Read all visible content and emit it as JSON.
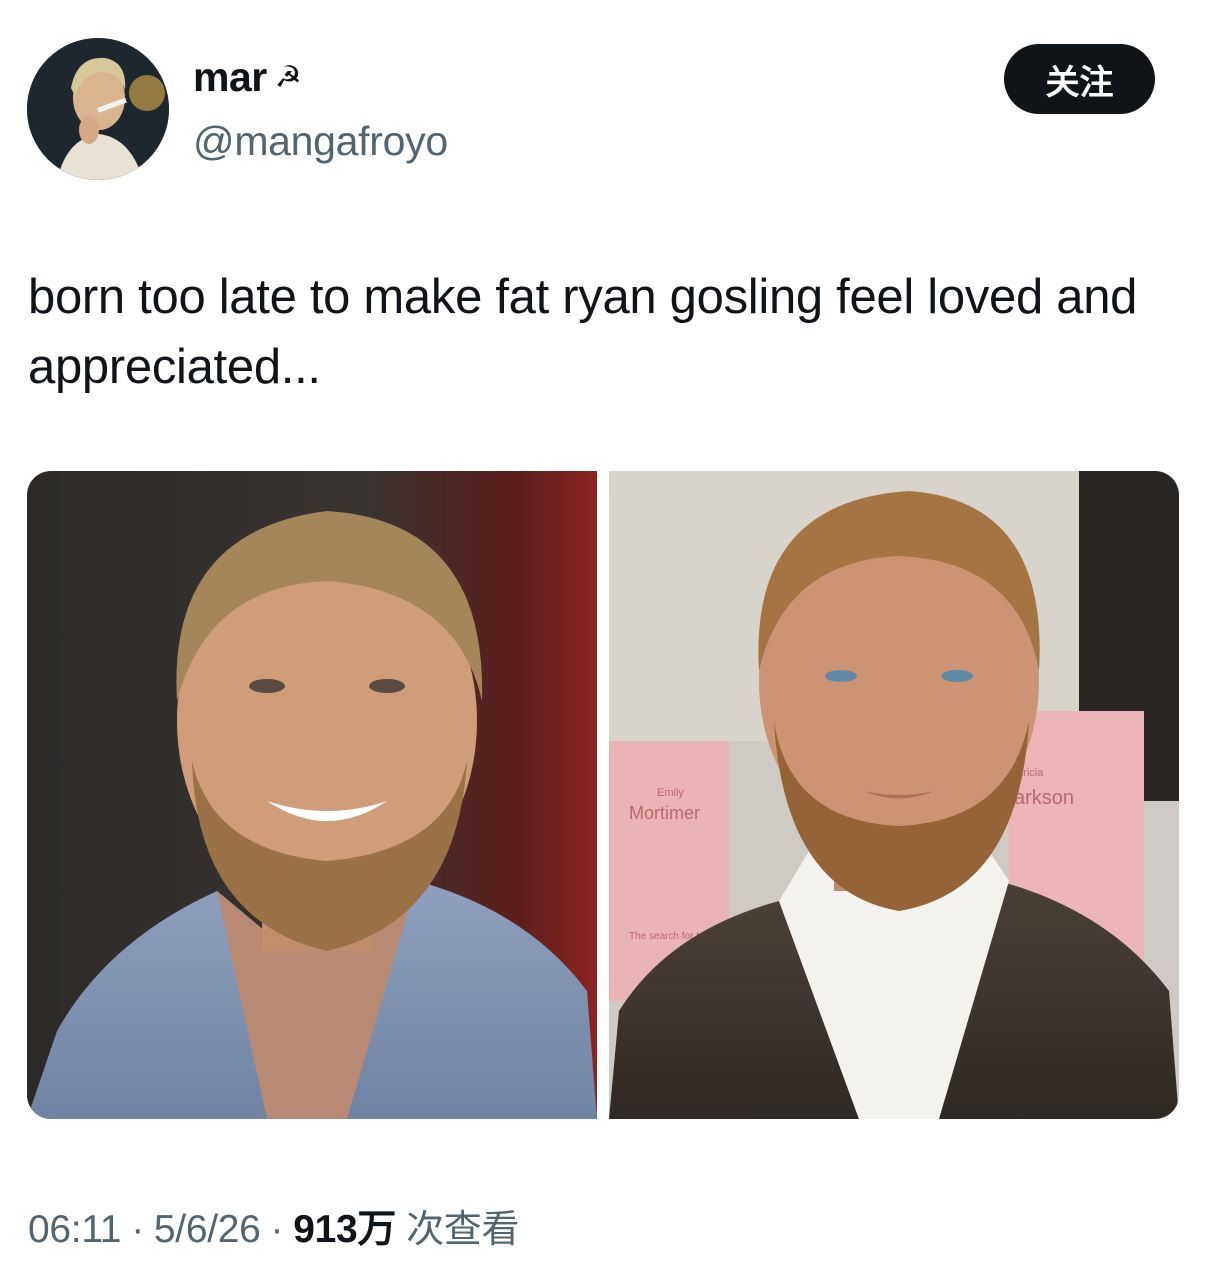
{
  "user": {
    "display_name": "mar",
    "name_emoji": "☭",
    "handle": "@mangafroyo",
    "avatar": "profile-photo-icon"
  },
  "follow_button": {
    "label": "关注"
  },
  "tweet": {
    "text": "born too late to make fat ryan gosling feel loved and appreciated..."
  },
  "media": {
    "images": [
      {
        "name": "photo-smiling-man-blue-shirt"
      },
      {
        "name": "photo-man-event-backdrop",
        "backdrop_text": {
          "left_small": "Emily",
          "left_big": "Mortimer",
          "right_small": "atricia",
          "right_big": "arkson",
          "tagline": "The search for true"
        }
      }
    ]
  },
  "meta": {
    "time": "06:11",
    "sep1": "·",
    "date": "5/6/26",
    "sep2": "·",
    "views_count": "913万",
    "views_label": "次查看"
  },
  "colors": {
    "text_primary": "#0f1419",
    "text_secondary": "#536471",
    "button_bg": "#0f1419"
  }
}
